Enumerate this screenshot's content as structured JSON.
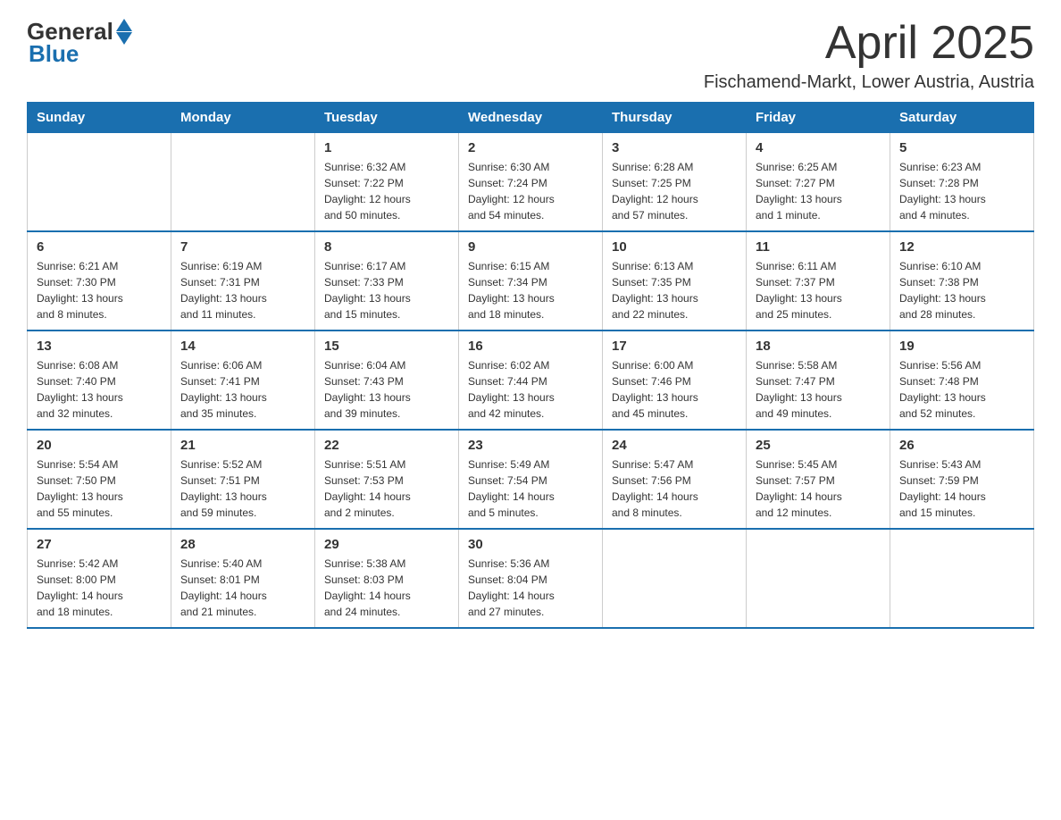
{
  "header": {
    "logo_general": "General",
    "logo_blue": "Blue",
    "title": "April 2025",
    "subtitle": "Fischamend-Markt, Lower Austria, Austria"
  },
  "days_of_week": [
    "Sunday",
    "Monday",
    "Tuesday",
    "Wednesday",
    "Thursday",
    "Friday",
    "Saturday"
  ],
  "weeks": [
    [
      {
        "day": "",
        "info": ""
      },
      {
        "day": "",
        "info": ""
      },
      {
        "day": "1",
        "info": "Sunrise: 6:32 AM\nSunset: 7:22 PM\nDaylight: 12 hours\nand 50 minutes."
      },
      {
        "day": "2",
        "info": "Sunrise: 6:30 AM\nSunset: 7:24 PM\nDaylight: 12 hours\nand 54 minutes."
      },
      {
        "day": "3",
        "info": "Sunrise: 6:28 AM\nSunset: 7:25 PM\nDaylight: 12 hours\nand 57 minutes."
      },
      {
        "day": "4",
        "info": "Sunrise: 6:25 AM\nSunset: 7:27 PM\nDaylight: 13 hours\nand 1 minute."
      },
      {
        "day": "5",
        "info": "Sunrise: 6:23 AM\nSunset: 7:28 PM\nDaylight: 13 hours\nand 4 minutes."
      }
    ],
    [
      {
        "day": "6",
        "info": "Sunrise: 6:21 AM\nSunset: 7:30 PM\nDaylight: 13 hours\nand 8 minutes."
      },
      {
        "day": "7",
        "info": "Sunrise: 6:19 AM\nSunset: 7:31 PM\nDaylight: 13 hours\nand 11 minutes."
      },
      {
        "day": "8",
        "info": "Sunrise: 6:17 AM\nSunset: 7:33 PM\nDaylight: 13 hours\nand 15 minutes."
      },
      {
        "day": "9",
        "info": "Sunrise: 6:15 AM\nSunset: 7:34 PM\nDaylight: 13 hours\nand 18 minutes."
      },
      {
        "day": "10",
        "info": "Sunrise: 6:13 AM\nSunset: 7:35 PM\nDaylight: 13 hours\nand 22 minutes."
      },
      {
        "day": "11",
        "info": "Sunrise: 6:11 AM\nSunset: 7:37 PM\nDaylight: 13 hours\nand 25 minutes."
      },
      {
        "day": "12",
        "info": "Sunrise: 6:10 AM\nSunset: 7:38 PM\nDaylight: 13 hours\nand 28 minutes."
      }
    ],
    [
      {
        "day": "13",
        "info": "Sunrise: 6:08 AM\nSunset: 7:40 PM\nDaylight: 13 hours\nand 32 minutes."
      },
      {
        "day": "14",
        "info": "Sunrise: 6:06 AM\nSunset: 7:41 PM\nDaylight: 13 hours\nand 35 minutes."
      },
      {
        "day": "15",
        "info": "Sunrise: 6:04 AM\nSunset: 7:43 PM\nDaylight: 13 hours\nand 39 minutes."
      },
      {
        "day": "16",
        "info": "Sunrise: 6:02 AM\nSunset: 7:44 PM\nDaylight: 13 hours\nand 42 minutes."
      },
      {
        "day": "17",
        "info": "Sunrise: 6:00 AM\nSunset: 7:46 PM\nDaylight: 13 hours\nand 45 minutes."
      },
      {
        "day": "18",
        "info": "Sunrise: 5:58 AM\nSunset: 7:47 PM\nDaylight: 13 hours\nand 49 minutes."
      },
      {
        "day": "19",
        "info": "Sunrise: 5:56 AM\nSunset: 7:48 PM\nDaylight: 13 hours\nand 52 minutes."
      }
    ],
    [
      {
        "day": "20",
        "info": "Sunrise: 5:54 AM\nSunset: 7:50 PM\nDaylight: 13 hours\nand 55 minutes."
      },
      {
        "day": "21",
        "info": "Sunrise: 5:52 AM\nSunset: 7:51 PM\nDaylight: 13 hours\nand 59 minutes."
      },
      {
        "day": "22",
        "info": "Sunrise: 5:51 AM\nSunset: 7:53 PM\nDaylight: 14 hours\nand 2 minutes."
      },
      {
        "day": "23",
        "info": "Sunrise: 5:49 AM\nSunset: 7:54 PM\nDaylight: 14 hours\nand 5 minutes."
      },
      {
        "day": "24",
        "info": "Sunrise: 5:47 AM\nSunset: 7:56 PM\nDaylight: 14 hours\nand 8 minutes."
      },
      {
        "day": "25",
        "info": "Sunrise: 5:45 AM\nSunset: 7:57 PM\nDaylight: 14 hours\nand 12 minutes."
      },
      {
        "day": "26",
        "info": "Sunrise: 5:43 AM\nSunset: 7:59 PM\nDaylight: 14 hours\nand 15 minutes."
      }
    ],
    [
      {
        "day": "27",
        "info": "Sunrise: 5:42 AM\nSunset: 8:00 PM\nDaylight: 14 hours\nand 18 minutes."
      },
      {
        "day": "28",
        "info": "Sunrise: 5:40 AM\nSunset: 8:01 PM\nDaylight: 14 hours\nand 21 minutes."
      },
      {
        "day": "29",
        "info": "Sunrise: 5:38 AM\nSunset: 8:03 PM\nDaylight: 14 hours\nand 24 minutes."
      },
      {
        "day": "30",
        "info": "Sunrise: 5:36 AM\nSunset: 8:04 PM\nDaylight: 14 hours\nand 27 minutes."
      },
      {
        "day": "",
        "info": ""
      },
      {
        "day": "",
        "info": ""
      },
      {
        "day": "",
        "info": ""
      }
    ]
  ]
}
